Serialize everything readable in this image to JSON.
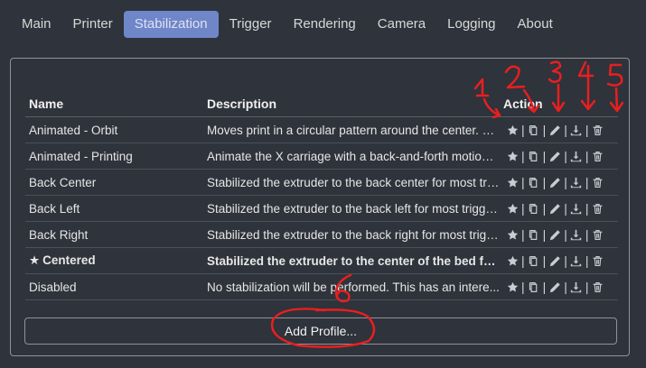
{
  "tabs": [
    {
      "label": "Main",
      "active": false
    },
    {
      "label": "Printer",
      "active": false
    },
    {
      "label": "Stabilization",
      "active": true
    },
    {
      "label": "Trigger",
      "active": false
    },
    {
      "label": "Rendering",
      "active": false
    },
    {
      "label": "Camera",
      "active": false
    },
    {
      "label": "Logging",
      "active": false
    },
    {
      "label": "About",
      "active": false
    }
  ],
  "table": {
    "headers": {
      "name": "Name",
      "description": "Description",
      "action": "Action"
    },
    "rows": [
      {
        "name": "Animated - Orbit",
        "description": "Moves print in a circular pattern around the center. B...",
        "default": false
      },
      {
        "name": "Animated - Printing",
        "description": "Animate the X carriage with a back-and-forth motion ...",
        "default": false
      },
      {
        "name": "Back Center",
        "description": "Stabilized the extruder to the back center for most tri...",
        "default": false
      },
      {
        "name": "Back Left",
        "description": "Stabilized the extruder to the back left for most trigge...",
        "default": false
      },
      {
        "name": "Back Right",
        "description": "Stabilized the extruder to the back right for most trigg...",
        "default": false
      },
      {
        "name": "Centered",
        "description": "Stabilized the extruder to the center of the bed fo...",
        "default": true
      },
      {
        "name": "Disabled",
        "description": "No stabilization will be performed. This has an intere...",
        "default": false
      }
    ]
  },
  "icons": {
    "default_marker": "star-icon",
    "actions": [
      "star-icon",
      "copy-icon",
      "pencil-icon",
      "download-icon",
      "trash-icon"
    ],
    "separator": "|"
  },
  "add_button": {
    "label": "Add Profile..."
  },
  "annotations": {
    "numbers": [
      "1",
      "2",
      "3",
      "4",
      "5",
      "6"
    ],
    "color": "#e81f1f"
  },
  "colors": {
    "background": "#2f333b",
    "tab_active": "#6f86c9",
    "icon": "#c8cdd3"
  }
}
